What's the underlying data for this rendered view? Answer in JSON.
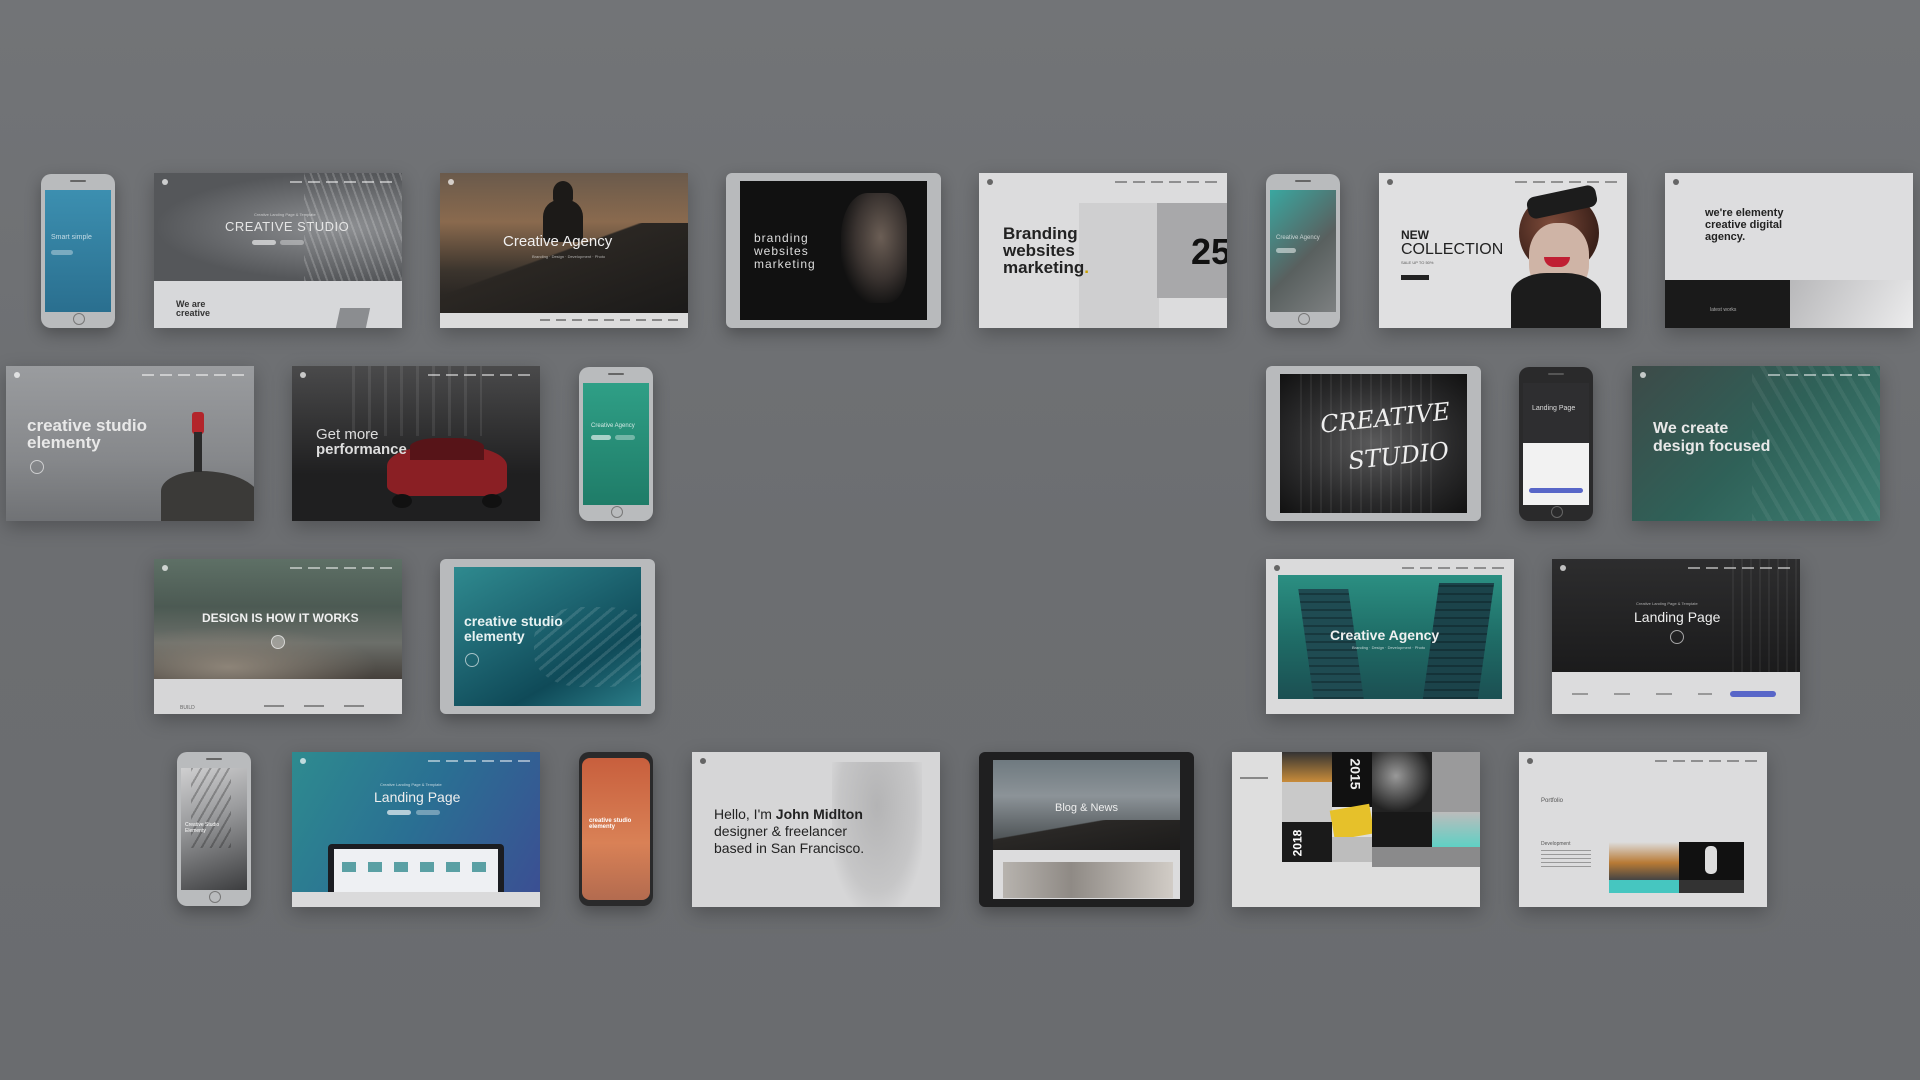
{
  "row1": {
    "phone1": {
      "text": "Smart simple"
    },
    "card_studio": {
      "eyebrow": "Creative Landing Page & Template",
      "title": "CREATIVE STUDIO",
      "footer": "We are\ncreative"
    },
    "card_agency": {
      "title": "Creative Agency",
      "sub": "Branding · Design · Development · Photo"
    },
    "tablet_branding": {
      "line1": "branding",
      "line2": "websites",
      "line3": "marketing"
    },
    "card_branding": {
      "line1": "Branding",
      "line2": "websites",
      "line3": "marketing",
      "dot": ".",
      "number": "25"
    },
    "phone2": {
      "text": "Creative Agency"
    },
    "card_collection": {
      "line1": "NEW",
      "line2": "COLLECTION",
      "sub": "SALE UP TO 50%"
    },
    "card_elementy": {
      "line1": "we're elementy",
      "line2": "creative digital",
      "line3": "agency.",
      "footer": "latest works"
    }
  },
  "row2": {
    "card_studio_elementy": {
      "line1": "creative studio",
      "line2": "elementy"
    },
    "card_performance": {
      "line1": "Get more",
      "line2": "performance"
    },
    "phone3": {
      "text": "Creative Agency"
    },
    "tablet_creative": {
      "line1": "CREATIVE",
      "line2": "STUDIO"
    },
    "phone4": {
      "text": "Landing Page"
    },
    "card_design": {
      "line1": "We create",
      "line2": "design focused"
    }
  },
  "row3": {
    "card_design_works": {
      "title": "DESIGN IS HOW IT WORKS",
      "footer": "BUILD"
    },
    "tablet_ocean": {
      "line1": "creative studio",
      "line2": "elementy"
    },
    "card_agency2": {
      "title": "Creative Agency",
      "sub": "Branding · Design · Development · Photo"
    },
    "card_landing": {
      "eyebrow": "Creative Landing Page & Template",
      "title": "Landing Page"
    }
  },
  "row4": {
    "phone5": {
      "text": "Creative Studio Elementy"
    },
    "card_landing2": {
      "eyebrow": "Creative Landing Page & Template",
      "title": "Landing Page"
    },
    "phone6": {
      "text": "creative studio elementy"
    },
    "card_hello": {
      "pre": "Hello, I'm ",
      "name": "John Midlton",
      "line2": "designer & freelancer",
      "line3": "based in San Francisco."
    },
    "tablet_blog": {
      "title": "Blog & News"
    },
    "card_collage": {
      "year": "2018",
      "num": "2015"
    },
    "card_portfolio": {
      "title": "Portfolio",
      "sub": "Development"
    }
  },
  "colors": {
    "background": "#6f7174",
    "accent": "#5866c8"
  }
}
